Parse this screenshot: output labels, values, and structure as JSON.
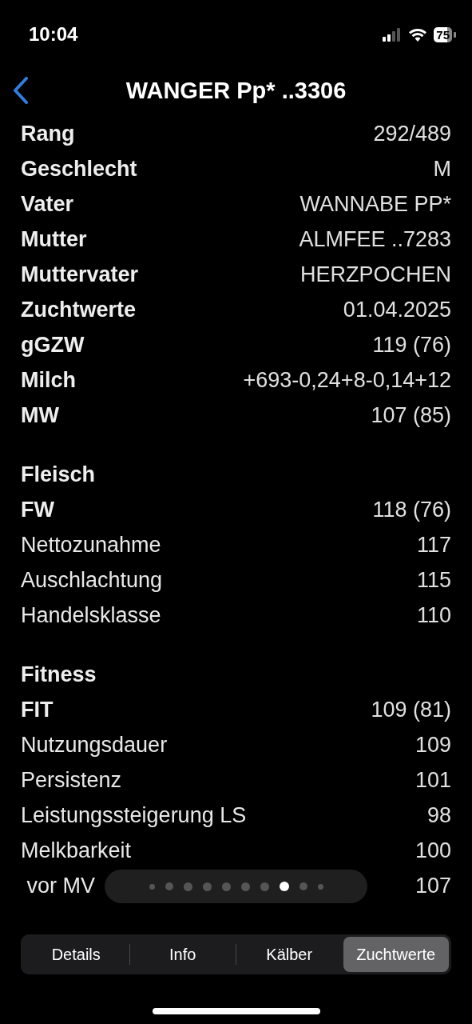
{
  "status_bar": {
    "time": "10:04",
    "battery": "75"
  },
  "nav": {
    "title": "WANGER Pp* ..3306"
  },
  "sections": [
    {
      "rows": [
        {
          "label": "Rang",
          "value": "292/489",
          "bold": true
        },
        {
          "label": "Geschlecht",
          "value": "M",
          "bold": true
        },
        {
          "label": "Vater",
          "value": "WANNABE PP*",
          "bold": true
        },
        {
          "label": "Mutter",
          "value": "ALMFEE ..7283",
          "bold": true
        },
        {
          "label": "Muttervater",
          "value": "HERZPOCHEN",
          "bold": true
        },
        {
          "label": "Zuchtwerte",
          "value": "01.04.2025",
          "bold": true
        },
        {
          "label": "gGZW",
          "value": "119 (76)",
          "bold": true
        },
        {
          "label": "Milch",
          "value": "+693-0,24+8-0,14+12",
          "bold": true
        },
        {
          "label": "MW",
          "value": "107 (85)",
          "bold": true
        }
      ]
    },
    {
      "title": "Fleisch",
      "rows": [
        {
          "label": "FW",
          "value": "118 (76)",
          "bold": true
        },
        {
          "label": "Nettozunahme",
          "value": "117",
          "bold": false
        },
        {
          "label": "Auschlachtung",
          "value": "115",
          "bold": false
        },
        {
          "label": "Handelsklasse",
          "value": "110",
          "bold": false
        }
      ]
    },
    {
      "title": "Fitness",
      "rows": [
        {
          "label": "FIT",
          "value": "109 (81)",
          "bold": true
        },
        {
          "label": "Nutzungsdauer",
          "value": "109",
          "bold": false
        },
        {
          "label": "Persistenz",
          "value": "101",
          "bold": false
        },
        {
          "label": "Leistungssteigerung LS",
          "value": "98",
          "bold": false
        },
        {
          "label": "Melkbarkeit",
          "value": "100",
          "bold": false
        },
        {
          "label": " vor MV",
          "value": "107",
          "bold": false
        }
      ]
    }
  ],
  "page_dots": [
    {
      "selected": false
    },
    {
      "selected": false
    },
    {
      "selected": false
    },
    {
      "selected": false
    },
    {
      "selected": false
    },
    {
      "selected": false
    },
    {
      "selected": false
    },
    {
      "selected": true
    },
    {
      "selected": false
    },
    {
      "selected": false
    }
  ],
  "tabs": [
    {
      "label": "Details",
      "selected": false
    },
    {
      "label": "Info",
      "selected": false
    },
    {
      "label": "Kälber",
      "selected": false
    },
    {
      "label": "Zuchtwerte",
      "selected": true
    }
  ]
}
